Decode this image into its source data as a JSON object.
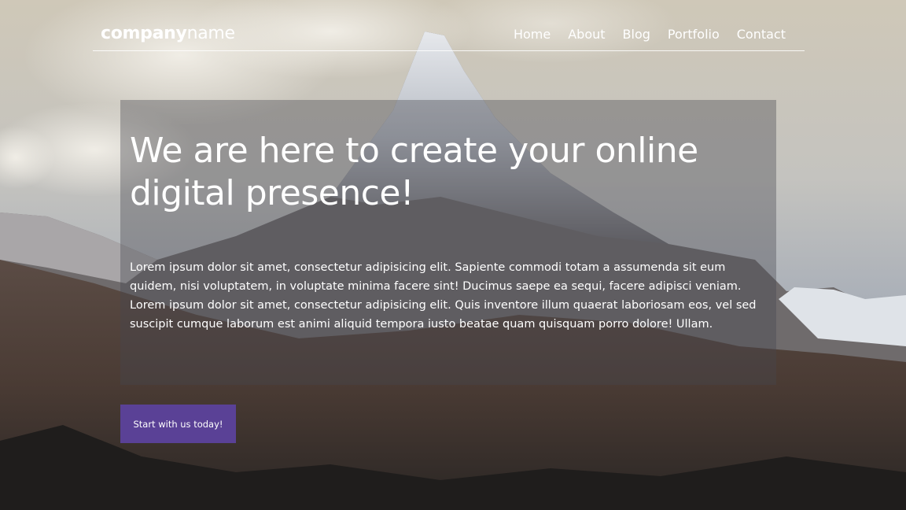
{
  "logo": {
    "bold": "company",
    "light": "name"
  },
  "nav": {
    "items": [
      {
        "label": "Home"
      },
      {
        "label": "About"
      },
      {
        "label": "Blog"
      },
      {
        "label": "Portfolio"
      },
      {
        "label": "Contact"
      }
    ]
  },
  "hero": {
    "headline": "We are here to create your online digital presence!",
    "body": "Lorem ipsum dolor sit amet, consectetur adipisicing elit. Sapiente commodi totam a assumenda sit eum quidem, nisi voluptatem, in voluptate minima facere sint! Ducimus saepe ea sequi, facere adipisci veniam. Lorem ipsum dolor sit amet, consectetur adipisicing elit. Quis inventore illum quaerat laboriosam eos, vel sed suscipit cumque laborum est animi aliquid tempora iusto beatae quam quisquam porro dolore! Ullam.",
    "cta_label": "Start with us today!"
  },
  "colors": {
    "cta_background": "#5a4196",
    "text": "#ffffff"
  }
}
